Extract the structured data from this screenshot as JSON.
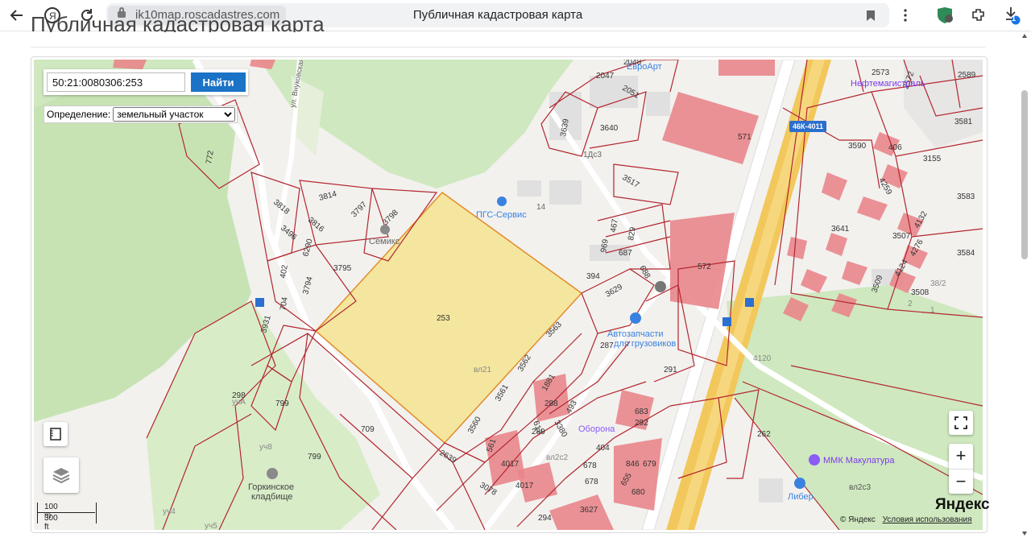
{
  "browser": {
    "url": "ik10map.roscadastres.com",
    "page_title": "Публичная кадастровая карта",
    "icons": [
      "back-icon",
      "yandex-icon",
      "reload-icon",
      "lock-icon",
      "bookmark-icon",
      "menu-icon",
      "shield-icon",
      "extensions-icon",
      "download-icon"
    ],
    "download_badge": "1"
  },
  "page": {
    "heading": "Публичная кадастровая карта"
  },
  "search": {
    "cadastral_number": "50:21:0080306:253",
    "find_label": "Найти"
  },
  "definition": {
    "label": "Определение:",
    "selected": "земельный участок"
  },
  "zoom": {
    "plus": "+",
    "minus": "−"
  },
  "scale": {
    "metric": "100 m",
    "imperial": "300 ft"
  },
  "attribution": {
    "brand": "Яндекс",
    "copyright": "© Яндекс",
    "terms": "Условия использования"
  },
  "map": {
    "highlighted_parcel": "253",
    "parcel_labels": [
      "772",
      "3818",
      "3814",
      "3797",
      "3798",
      "3816",
      "3496",
      "6290",
      "3795",
      "3794",
      "402",
      "704",
      "3931",
      "298",
      "799",
      "709",
      "3560",
      "3561",
      "2639",
      "3078",
      "561",
      "4017",
      "294",
      "3627",
      "1881",
      "493",
      "288",
      "617",
      "3380",
      "289",
      "404",
      "678",
      "846",
      "679",
      "683",
      "292",
      "655",
      "680",
      "3562",
      "3563",
      "287",
      "291",
      "262",
      "3629",
      "394",
      "969",
      "687",
      "688",
      "829",
      "467",
      "3517",
      "3639",
      "3640",
      "2047",
      "2051",
      "2048",
      "571",
      "572",
      "3590",
      "406",
      "4259",
      "3155",
      "3581",
      "2573",
      "2572",
      "2589",
      "3583",
      "3641",
      "3507",
      "4132",
      "4276",
      "3584",
      "3509",
      "4124",
      "3508",
      "38/2",
      "2",
      "1",
      "4120",
      "14",
      "1Дс3",
      "вл21",
      "учА",
      "уч8",
      "уч4",
      "уч5",
      "вл2с3",
      "вл2с2"
    ],
    "pois": [
      "ПГС-Сервис",
      "Семикс",
      "Автозапчасти для грузовиков",
      "ММК Макулатура",
      "Либер",
      "Горкинское кладбище",
      "Нефтемагистраль",
      "ЕвроАрт",
      "Оборона"
    ],
    "road_label": "46К-4011",
    "street_label": "ул. Внуковская"
  }
}
